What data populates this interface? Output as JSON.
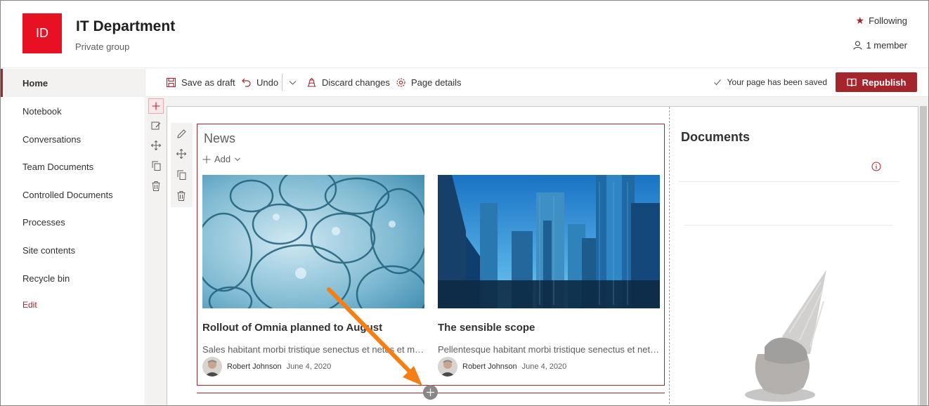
{
  "site": {
    "logo_text": "ID",
    "title": "IT Department",
    "subtitle": "Private group",
    "following": "Following",
    "members": "1 member",
    "brand_color": "#e81123",
    "accent_color": "#a4262c"
  },
  "nav": {
    "items": [
      {
        "label": "Home"
      },
      {
        "label": "Notebook"
      },
      {
        "label": "Conversations"
      },
      {
        "label": "Team Documents"
      },
      {
        "label": "Controlled Documents"
      },
      {
        "label": "Processes"
      },
      {
        "label": "Site contents"
      },
      {
        "label": "Recycle bin"
      }
    ],
    "edit": "Edit"
  },
  "toolbar": {
    "save_draft": "Save as draft",
    "undo": "Undo",
    "discard": "Discard changes",
    "page_details": "Page details",
    "status": "Your page has been saved",
    "republish": "Republish"
  },
  "news": {
    "title": "News",
    "add": "Add",
    "cards": [
      {
        "title": "Rollout of Omnia planned to August",
        "description": "Sales habitant morbi tristique senectus et netus et malesuada fames",
        "author": "Robert Johnson",
        "date": "June 4, 2020"
      },
      {
        "title": "The sensible scope",
        "description": "Pellentesque habitant morbi tristique senectus et netus et malesuada",
        "author": "Robert Johnson",
        "date": "June 4, 2020"
      }
    ]
  },
  "documents": {
    "title": "Documents"
  },
  "icons": {
    "follow": "star-icon",
    "member": "person-icon",
    "save": "floppy-icon",
    "undo": "undo-icon",
    "dropdown": "chevron-down-icon",
    "discard": "discard-icon",
    "details": "gear-icon",
    "saved": "checkmark-icon",
    "republish": "book-icon",
    "add": "plus-icon",
    "edit": "pencil-icon",
    "move": "move-icon",
    "duplicate": "copy-icon",
    "delete": "trash-icon",
    "info": "info-icon",
    "arrow": "orange-arrow-annotation"
  }
}
